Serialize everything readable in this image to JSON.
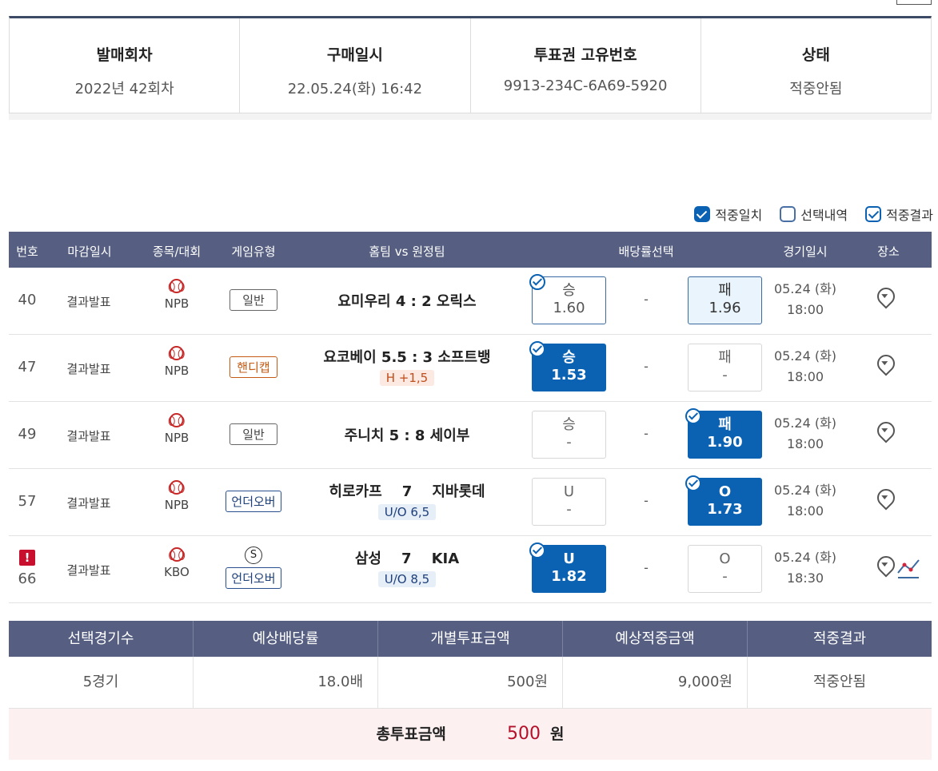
{
  "info": {
    "cells": [
      {
        "label": "발매회차",
        "value": "2022년 42회차"
      },
      {
        "label": "구매일시",
        "value": "22.05.24(화) 16:42"
      },
      {
        "label": "투표권 고유번호",
        "value": "9913-234C-6A69-5920"
      },
      {
        "label": "상태",
        "value": "적중안됨"
      }
    ]
  },
  "legend": {
    "items": [
      {
        "label": "적중일치",
        "checked": true
      },
      {
        "label": "선택내역",
        "checked": false
      },
      {
        "label": "적중결과",
        "checked": true
      }
    ]
  },
  "games": {
    "headers": [
      "번호",
      "마감일시",
      "종목/대회",
      "게임유형",
      "홈팀 vs 원정팀",
      "배당률선택",
      "경기일시",
      "장소"
    ],
    "rows": [
      {
        "no": "40",
        "close": "결과발표",
        "league": "NPB",
        "type": "일반",
        "match": "요미우리 4 : 2 오릭스",
        "sub": "",
        "left_label": "승",
        "left_value": "1.60",
        "draw": "-",
        "right_label": "패",
        "right_value": "1.96",
        "date": "05.24 (화)",
        "time": "18:00"
      },
      {
        "no": "47",
        "close": "결과발표",
        "league": "NPB",
        "type": "핸디캡",
        "match": "요코베이 5.5 : 3 소프트뱅",
        "sub": "H +1,5",
        "left_label": "승",
        "left_value": "1.53",
        "draw": "-",
        "right_label": "패",
        "right_value": "-",
        "date": "05.24 (화)",
        "time": "18:00"
      },
      {
        "no": "49",
        "close": "결과발표",
        "league": "NPB",
        "type": "일반",
        "match": "주니치 5 : 8 세이부",
        "sub": "",
        "left_label": "승",
        "left_value": "-",
        "draw": "-",
        "right_label": "패",
        "right_value": "1.90",
        "date": "05.24 (화)",
        "time": "18:00"
      },
      {
        "no": "57",
        "close": "결과발표",
        "league": "NPB",
        "type": "언더오버",
        "match": "히로카프    7    지바롯데",
        "sub": "U/O 6,5",
        "left_label": "U",
        "left_value": "-",
        "draw": "-",
        "right_label": "O",
        "right_value": "1.73",
        "date": "05.24 (화)",
        "time": "18:00"
      },
      {
        "no": "66",
        "close": "결과발표",
        "league": "KBO",
        "type": "언더오버",
        "special": "S",
        "alert": "!",
        "match": "삼성    7    KIA",
        "sub": "U/O 8,5",
        "left_label": "U",
        "left_value": "1.82",
        "draw": "-",
        "right_label": "O",
        "right_value": "-",
        "date": "05.24 (화)",
        "time": "18:30"
      }
    ]
  },
  "summary": {
    "headers": [
      "선택경기수",
      "예상배당률",
      "개별투표금액",
      "예상적중금액",
      "적중결과"
    ],
    "values": [
      "5경기",
      "18.0배",
      "500원",
      "9,000원",
      "적중안됨"
    ],
    "total_label": "총투표금액",
    "total_amount": "500",
    "total_unit": "원"
  },
  "colors": {
    "header_bg": "#565f82",
    "selected": "#0b62b3",
    "accent_red": "#b5102a"
  }
}
